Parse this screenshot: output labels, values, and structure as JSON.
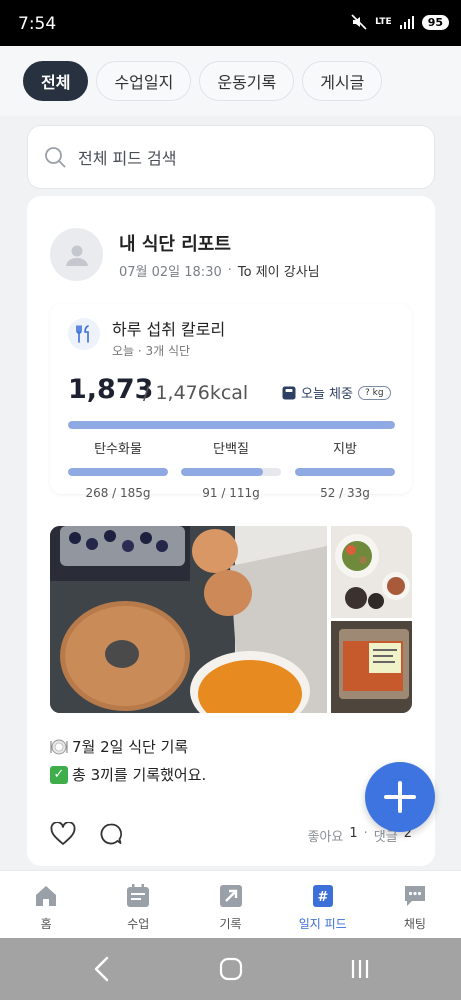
{
  "status_bar": {
    "time": "7:54",
    "network": "LTE",
    "battery": "95"
  },
  "tabs": [
    {
      "label": "전체",
      "active": true
    },
    {
      "label": "수업일지",
      "active": false
    },
    {
      "label": "운동기록",
      "active": false
    },
    {
      "label": "게시글",
      "active": false
    }
  ],
  "search": {
    "placeholder": "전체 피드 검색"
  },
  "post": {
    "title": "내 식단 리포트",
    "date": "07월 02일 18:30",
    "separator": "·",
    "recipient": "To 제이 강사님",
    "calorie": {
      "title": "하루 섭취 칼로리",
      "subtitle": "오늘 · 3개 식단",
      "consumed": "1,873",
      "target": "/ 1,476kcal",
      "consumed_fraction": 1.0,
      "weight_label": "오늘 체중",
      "weight_value": "? kg",
      "macros": [
        {
          "label": "탄수화물",
          "value": "268 / 185g",
          "fraction": 1.0
        },
        {
          "label": "단백질",
          "value": "91 / 111g",
          "fraction": 0.82
        },
        {
          "label": "지방",
          "value": "52 / 33g",
          "fraction": 1.0
        }
      ]
    },
    "caption": {
      "line1": "7월 2일 식단 기록",
      "line2": "총 3끼를 기록했어요."
    },
    "likes_label": "좋아요",
    "likes_count": "1",
    "comments_label": "댓글",
    "comments_count": "2",
    "counts_separator": "·"
  },
  "bottom_nav": [
    {
      "label": "홈",
      "icon": "home-icon",
      "active": false
    },
    {
      "label": "수업",
      "icon": "calendar-icon",
      "active": false
    },
    {
      "label": "기록",
      "icon": "record-icon",
      "active": false
    },
    {
      "label": "일지 피드",
      "icon": "feed-icon",
      "active": true
    },
    {
      "label": "채팅",
      "icon": "chat-icon",
      "active": false
    }
  ],
  "colors": {
    "accent": "#3d74e0",
    "active_tab": "#27313f",
    "bar": "#8fa9e3",
    "nav_active": "#3d6fd8"
  }
}
